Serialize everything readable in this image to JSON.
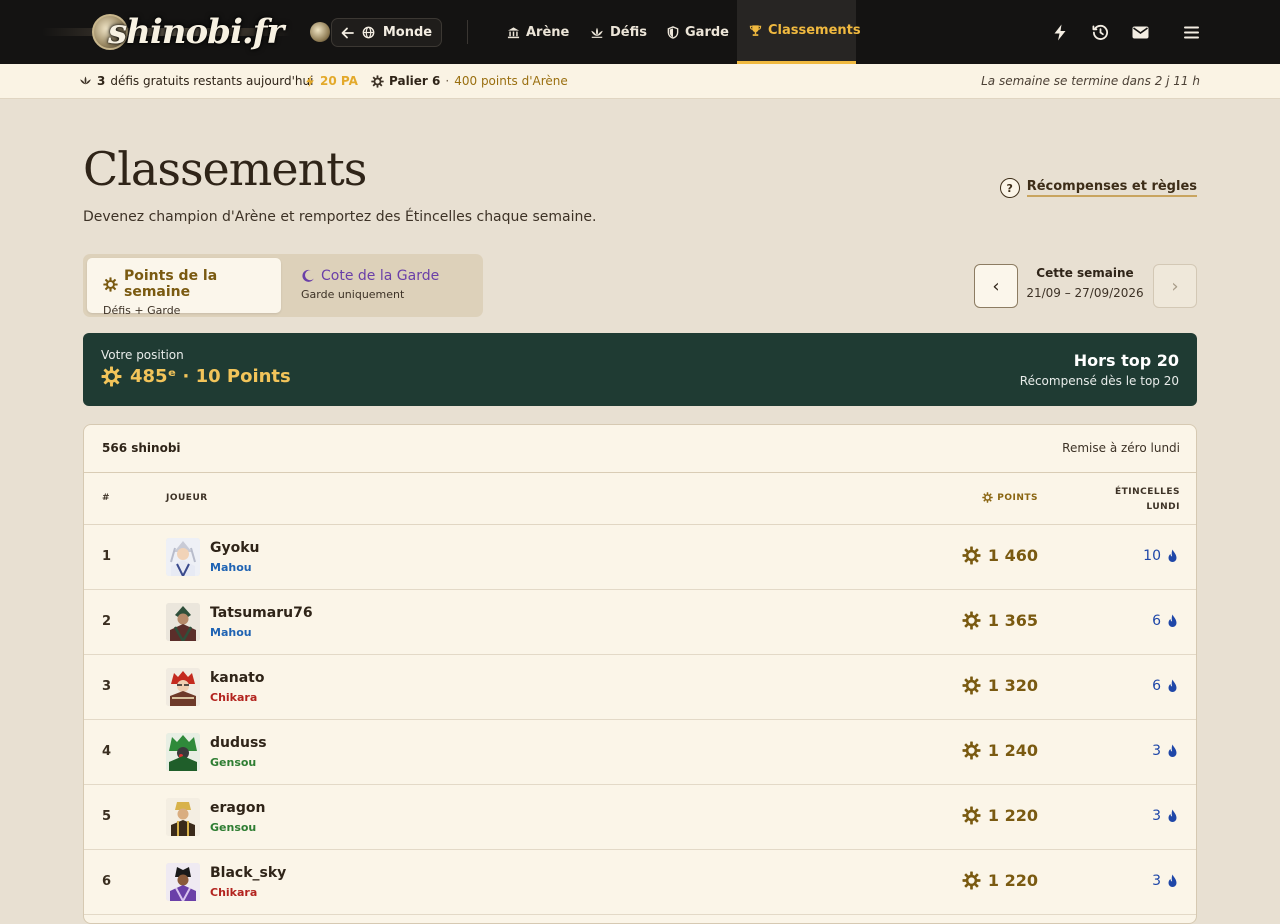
{
  "nav": {
    "logo_text": "shinobi.fr",
    "monde_label": "Monde",
    "items": [
      {
        "label": "Arène"
      },
      {
        "label": "Défis"
      },
      {
        "label": "Garde"
      },
      {
        "label": "Classements"
      }
    ],
    "active_item": "Classements",
    "accent_color": "#f0b93f"
  },
  "statusbar": {
    "free_challenges": "3",
    "free_challenges_text": "défis gratuits restants aujourd'hui",
    "pa": "20 PA",
    "tier": "Palier 6",
    "tier_separator": "·",
    "arena_points": "400 points d'Arène",
    "week_end": "La semaine se termine dans 2 j 11 h"
  },
  "header": {
    "title": "Classements",
    "subtitle": "Devenez champion d'Arène et remportez des Étincelles chaque semaine.",
    "rules_link": "Récompenses et règles",
    "rules_icon": "?"
  },
  "tabs": [
    {
      "label": "Points de la semaine",
      "sub": "Défis + Garde"
    },
    {
      "label": "Cote de la Garde",
      "sub": "Garde uniquement"
    }
  ],
  "week": {
    "label": "Cette semaine",
    "range": "21/09 – 27/09/2026",
    "prev_glyph": "‹",
    "next_glyph": "›"
  },
  "position": {
    "label": "Votre position",
    "value": "485ᵉ · 10 Points",
    "status": "Hors top 20",
    "note": "Récompensé dès le top 20"
  },
  "table": {
    "count": "566 shinobi",
    "reset": "Remise à zéro lundi",
    "headers": {
      "rank": "#",
      "player": "JOUEUR",
      "points": "POINTS",
      "sparks_line1": "ÉTINCELLES",
      "sparks_line2": "LUNDI"
    },
    "rows": [
      {
        "rank": "1",
        "name": "Gyoku",
        "clan": "Mahou",
        "points": "1 460",
        "sparks": "10"
      },
      {
        "rank": "2",
        "name": "Tatsumaru76",
        "clan": "Mahou",
        "points": "1 365",
        "sparks": "6"
      },
      {
        "rank": "3",
        "name": "kanato",
        "clan": "Chikara",
        "points": "1 320",
        "sparks": "6"
      },
      {
        "rank": "4",
        "name": "duduss",
        "clan": "Gensou",
        "points": "1 240",
        "sparks": "3"
      },
      {
        "rank": "5",
        "name": "eragon",
        "clan": "Gensou",
        "points": "1 220",
        "sparks": "3"
      },
      {
        "rank": "6",
        "name": "Black_sky",
        "clan": "Chikara",
        "points": "1 220",
        "sparks": "3"
      }
    ]
  },
  "colors": {
    "clan_mahou": "#1f63b3",
    "clan_chikara": "#b3241f",
    "clan_gensou": "#2e7d32",
    "points": "#7a5a11",
    "sparks": "#1f47a8",
    "banner_bg": "#1f3b33"
  },
  "icons": {
    "back": "arrow-left-icon",
    "globe": "globe-icon",
    "arena": "temple-icon",
    "challenges": "lotus-icon",
    "guard": "shield-icon",
    "rankings": "trophy-icon",
    "energy": "bolt-icon",
    "history": "history-icon",
    "mail": "mail-icon",
    "menu": "menu-icon",
    "points": "sun-gear-icon",
    "crescent": "crescent-icon",
    "spark": "flame-icon"
  }
}
